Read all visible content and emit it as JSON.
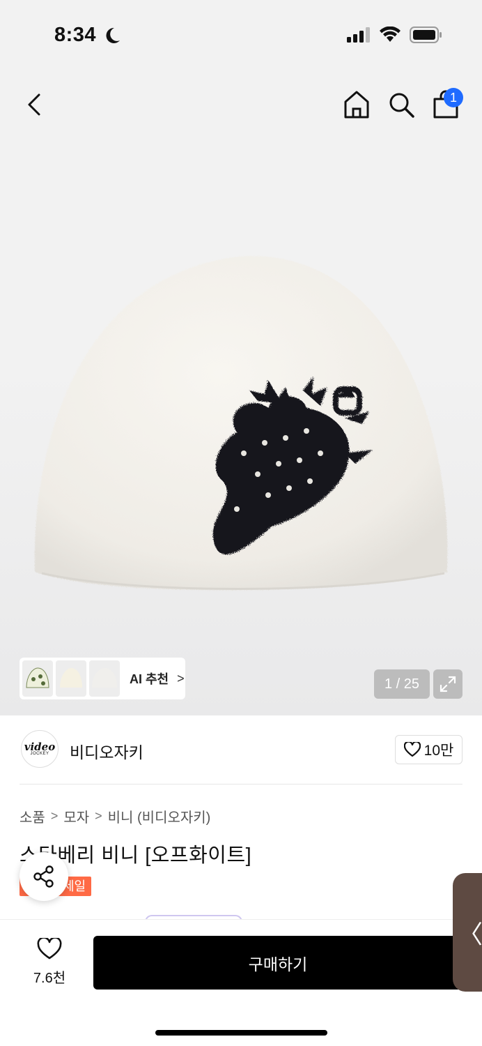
{
  "status_bar": {
    "time": "8:34"
  },
  "header": {
    "cart_count": "1"
  },
  "gallery": {
    "ai_recommend_label": "AI 추천",
    "ai_chevron": ">",
    "pager": "1 / 25"
  },
  "brand": {
    "logo_text": "video",
    "logo_subtext": "JOCKEY",
    "name": "비디오자키",
    "likes": "10만"
  },
  "breadcrumb": {
    "items": [
      "소품",
      "모자",
      "비니 (비디오자키)"
    ],
    "separator": ">"
  },
  "product": {
    "title": "스타베리 비니 [오프화이트]",
    "sale_label": "세일"
  },
  "bottom": {
    "wish_count": "7.6천",
    "buy_label": "구매하기",
    "side_tab_label": "〈"
  },
  "colors": {
    "buy_button": "#000000",
    "sale_tag": "#ff6a45",
    "cart_badge": "#1f6bff"
  }
}
